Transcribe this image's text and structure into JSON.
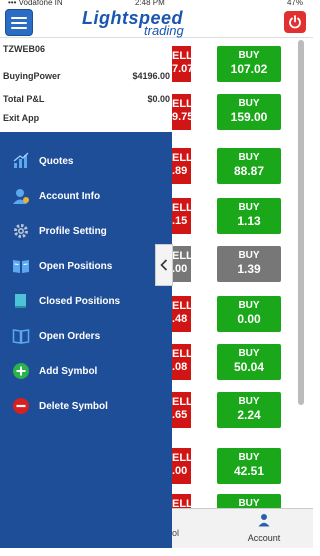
{
  "status_bar": {
    "carrier": "••• Vodafone IN",
    "time": "2:48 PM",
    "battery": "47%"
  },
  "header": {
    "logo_main": "Lightspeed",
    "logo_sub": "trading"
  },
  "account": {
    "id": "TZWEB06",
    "buying_power_label": "BuyingPower",
    "buying_power_value": "$4196.00",
    "total_pl_label": "Total P&L",
    "total_pl_value": "$0.00",
    "exit_label": "Exit App"
  },
  "menu": [
    {
      "label": "Quotes",
      "icon": "bar-chart-icon"
    },
    {
      "label": "Account Info",
      "icon": "user-icon"
    },
    {
      "label": "Profile Setting",
      "icon": "gear-icon"
    },
    {
      "label": "Open Positions",
      "icon": "open-book-icon"
    },
    {
      "label": "Closed Positions",
      "icon": "closed-book-icon"
    },
    {
      "label": "Open Orders",
      "icon": "book-outline-icon"
    },
    {
      "label": "Add Symbol",
      "icon": "plus-circle-icon"
    },
    {
      "label": "Delete Symbol",
      "icon": "minus-circle-icon"
    }
  ],
  "quotes": [
    {
      "sell_label": "ELL",
      "sell_value": "7.07",
      "buy_label": "BUY",
      "buy_value": "107.02",
      "disabled": false
    },
    {
      "sell_label": "ELL",
      "sell_value": "9.75",
      "buy_label": "BUY",
      "buy_value": "159.00",
      "disabled": false
    },
    {
      "sell_label": "ELL",
      "sell_value": ".89",
      "buy_label": "BUY",
      "buy_value": "88.87",
      "disabled": false
    },
    {
      "sell_label": "ELL",
      "sell_value": ".15",
      "buy_label": "BUY",
      "buy_value": "1.13",
      "disabled": false
    },
    {
      "sell_label": "ELL",
      "sell_value": ".00",
      "buy_label": "BUY",
      "buy_value": "1.39",
      "disabled": true
    },
    {
      "sell_label": "ELL",
      "sell_value": ".48",
      "buy_label": "BUY",
      "buy_value": "0.00",
      "disabled": false
    },
    {
      "sell_label": "ELL",
      "sell_value": ".08",
      "buy_label": "BUY",
      "buy_value": "50.04",
      "disabled": false
    },
    {
      "sell_label": "ELL",
      "sell_value": ".65",
      "buy_label": "BUY",
      "buy_value": "2.24",
      "disabled": false
    },
    {
      "sell_label": "ELL",
      "sell_value": ".00",
      "buy_label": "BUY",
      "buy_value": "42.51",
      "disabled": false
    },
    {
      "sell_label": "ELL",
      "sell_value": "",
      "buy_label": "BUY",
      "buy_value": "",
      "disabled": false
    }
  ],
  "bottom_tabs": {
    "left_partial": "ol",
    "account": "Account"
  },
  "colors": {
    "drawer": "#1f4e99",
    "sell": "#d11515",
    "buy": "#1aa81a",
    "disabled": "#777777"
  }
}
